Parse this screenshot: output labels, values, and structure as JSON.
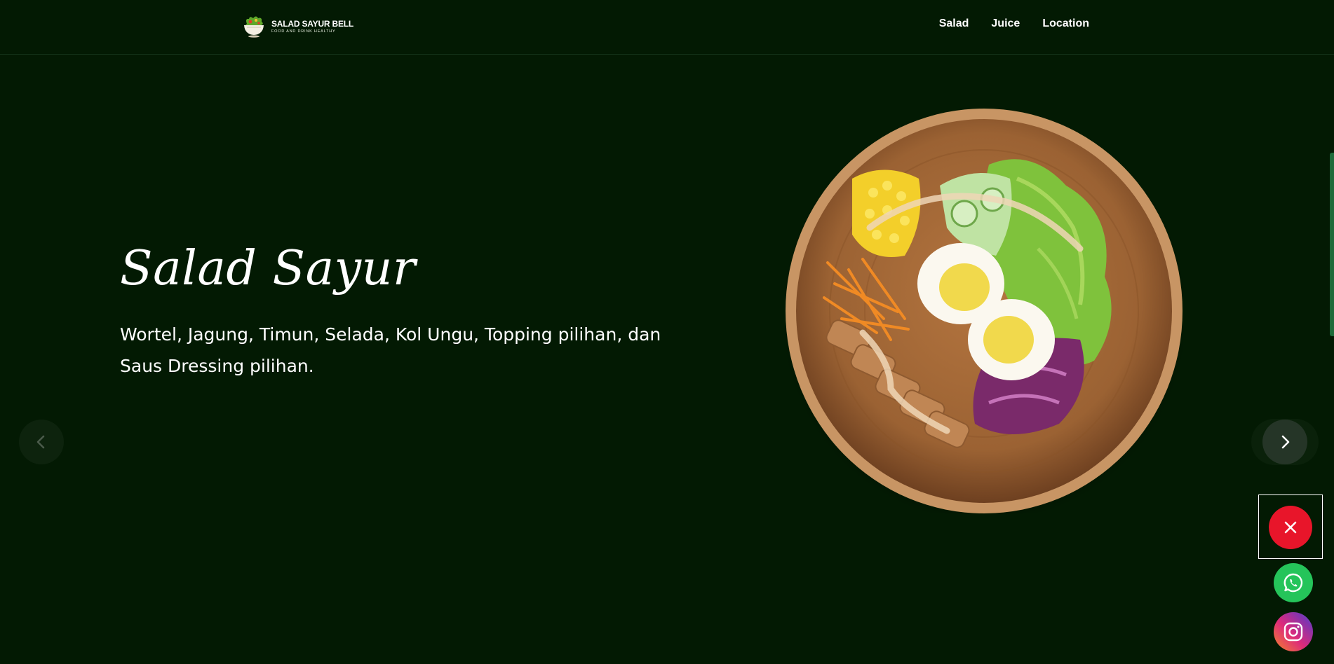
{
  "header": {
    "brand_name": "SALAD SAYUR BELL",
    "brand_tagline": "FOOD AND DRINK HEALTHY",
    "nav": [
      {
        "label": "Salad"
      },
      {
        "label": "Juice"
      },
      {
        "label": "Location"
      }
    ]
  },
  "hero": {
    "title": "Salad Sayur",
    "description": "Wortel, Jagung, Timun, Selada, Kol Ungu, Topping pilihan, dan Saus Dressing pilihan."
  },
  "slider": {
    "prev_icon": "chevron-left-icon",
    "next_icon": "chevron-right-icon"
  },
  "floating": {
    "close_icon": "close-icon",
    "whatsapp_icon": "whatsapp-icon",
    "instagram_icon": "instagram-icon"
  },
  "colors": {
    "background": "#031a03",
    "close": "#e8152a",
    "whatsapp": "#25c45a"
  }
}
